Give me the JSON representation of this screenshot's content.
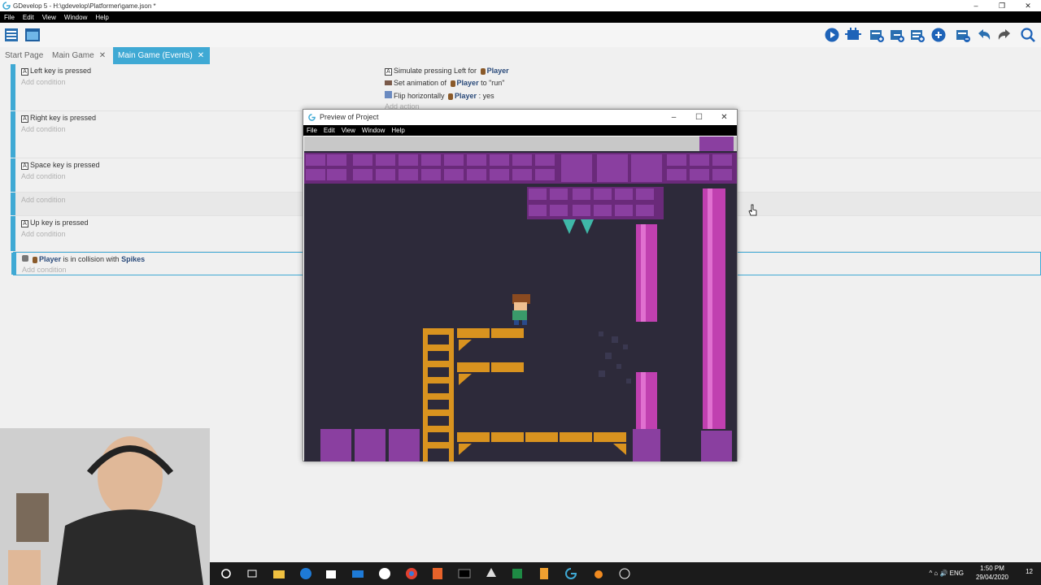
{
  "window": {
    "title": "GDevelop 5 - H:\\gdevelop\\Platformer\\game.json *",
    "controls": [
      "–",
      "❐",
      "✕"
    ]
  },
  "menu": [
    "File",
    "Edit",
    "View",
    "Window",
    "Help"
  ],
  "toolbar": {
    "left_icons": [
      "project-manager-icon",
      "scene-icon"
    ],
    "right_icons": [
      "preview-play-icon",
      "debugger-icon",
      "add-event-icon",
      "add-subevent-icon",
      "add-comment-icon",
      "add-more-icon",
      "delete-event-icon",
      "undo-icon",
      "redo-icon",
      "search-icon"
    ]
  },
  "tabs": [
    {
      "label": "Start Page",
      "closable": false,
      "active": false
    },
    {
      "label": "Main Game",
      "closable": true,
      "active": false
    },
    {
      "label": "Main Game (Events)",
      "closable": true,
      "active": true
    }
  ],
  "events": [
    {
      "condition_pre": "Left",
      "condition_post": " key is pressed",
      "add_condition": "Add condition",
      "actions": [
        {
          "pre": "Simulate pressing Left for ",
          "obj": "Player",
          "post": ""
        },
        {
          "pre": "Set animation of ",
          "obj": "Player",
          "post": " to \"run\""
        },
        {
          "pre": "Flip horizontally ",
          "obj": "Player",
          "post": " : yes"
        }
      ],
      "add_action": "Add action"
    },
    {
      "condition_pre": "Right",
      "condition_post": " key is pressed",
      "add_condition": "Add condition"
    },
    {
      "condition_pre": "Space",
      "condition_post": " key is pressed",
      "add_condition": "Add condition"
    },
    {
      "add_condition": "Add condition"
    },
    {
      "condition_pre": "Up",
      "condition_post": " key is pressed",
      "add_condition": "Add condition"
    },
    {
      "collision": {
        "obj": "Player",
        "mid": " is in collision with ",
        "target": "Spikes"
      },
      "add_condition": "Add condition"
    }
  ],
  "preview": {
    "title": "Preview of Project",
    "menu": [
      "File",
      "Edit",
      "View",
      "Window",
      "Help"
    ],
    "controls": [
      "–",
      "☐",
      "✕"
    ]
  },
  "taskbar": {
    "icons": [
      "cortana-icon",
      "task-view-icon",
      "file-explorer-icon",
      "edge-icon",
      "store-icon",
      "mail-icon",
      "xbox-icon",
      "chrome-icon",
      "office-icon",
      "terminal-icon",
      "inkscape-icon",
      "excel-icon",
      "sublime-icon",
      "gdevelop-icon",
      "blender-icon",
      "clock-app-icon"
    ],
    "tray": "^  ⌂  🔊  ENG",
    "time": "1:50 PM",
    "date": "29/04/2020",
    "notif": "12"
  },
  "colors": {
    "accent": "#3fa9d4",
    "purple": "#8a3fa0",
    "orange": "#d9931f",
    "bg_game": "#2d2a3a"
  }
}
